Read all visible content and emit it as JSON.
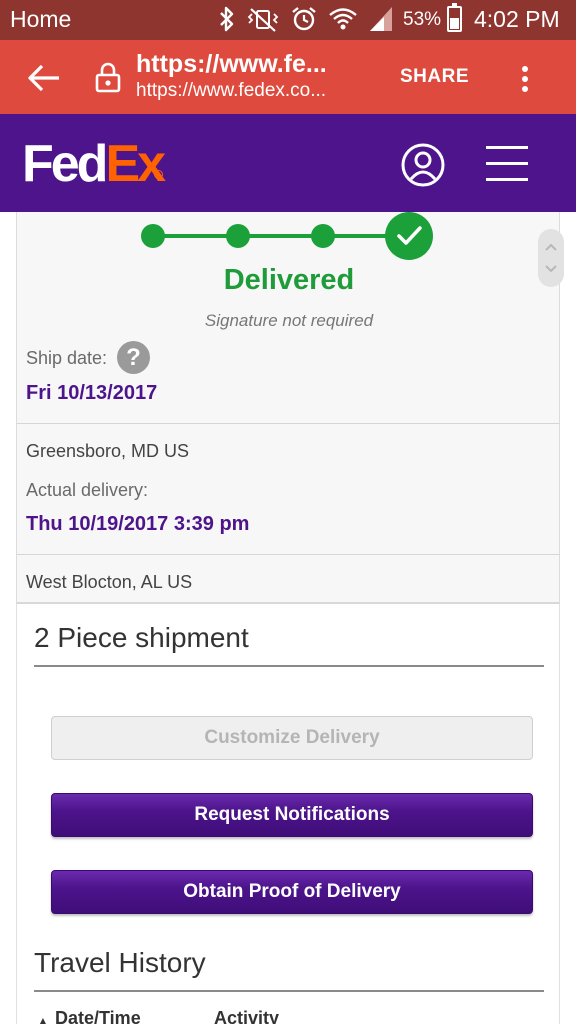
{
  "status_bar": {
    "home_label": "Home",
    "battery_percent": "53%",
    "battery_level": 0.53,
    "time": "4:02 PM",
    "icons": [
      "bluetooth-icon",
      "vibrate-mute-icon",
      "alarm-icon",
      "wifi-icon",
      "cell-signal-icon",
      "battery-icon"
    ]
  },
  "browser": {
    "url_title": "https://www.fe...",
    "url_sub": "https://www.fedex.co...",
    "share_label": "SHARE",
    "icons": [
      "back-arrow-icon",
      "lock-icon",
      "more-vert-icon"
    ]
  },
  "header": {
    "logo_fed": "Fed",
    "logo_ex": "Ex",
    "logo_registered": "®",
    "brand_colors": {
      "purple": "#4d148c",
      "orange": "#ff6200"
    },
    "icons": [
      "user-account-icon",
      "hamburger-menu-icon"
    ]
  },
  "tracking": {
    "progress_steps_total": 5,
    "progress_steps_completed": 5,
    "progress_color": "#1ca13a",
    "status": "Delivered",
    "signature_note": "Signature not required",
    "ship_date_label": "Ship date:",
    "help_symbol": "?",
    "ship_date": "Fri 10/13/2017",
    "origin": "Greensboro, MD US",
    "actual_delivery_label": "Actual delivery:",
    "actual_delivery": "Thu 10/19/2017 3:39 pm",
    "destination": "West Blocton, AL US"
  },
  "shipment": {
    "title": "2 Piece shipment",
    "customize_label": "Customize Delivery",
    "notifications_label": "Request Notifications",
    "proof_label": "Obtain Proof of Delivery"
  },
  "travel_history": {
    "title": "Travel History",
    "columns": [
      "Date/Time",
      "Activity"
    ],
    "sort_symbol": "▲"
  }
}
